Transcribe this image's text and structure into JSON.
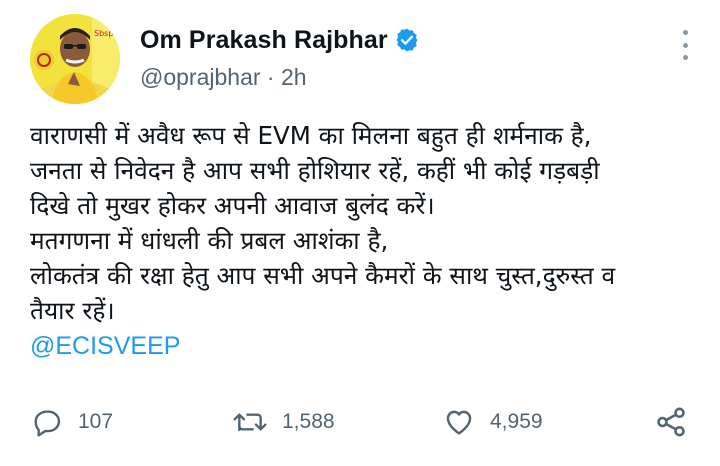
{
  "author": {
    "display_name": "Om Prakash Rajbhar",
    "handle": "@oprajbhar",
    "separator": "·",
    "time": "2h",
    "verified": true,
    "avatar_badge_text": "Sbsp"
  },
  "tweet": {
    "lines": [
      "वाराणसी में अवैध रूप से EVM का मिलना बहुत ही शर्मनाक है,",
      "जनता से निवेदन है आप सभी होशियार रहें, कहीं भी कोई गड़बड़ी",
      "दिखे तो मुखर होकर अपनी आवाज बुलंद करें।",
      "मतगणना में धांधली की प्रबल आशंका है,",
      "लोकतंत्र की रक्षा हेतु आप सभी अपने कैमरों के साथ चुस्त,दुरुस्त व",
      "तैयार रहें।"
    ],
    "mention": "@ECISVEEP"
  },
  "actions": {
    "replies": "107",
    "retweets": "1,588",
    "likes": "4,959"
  },
  "icons": {
    "reply": "reply-icon",
    "retweet": "retweet-icon",
    "like": "heart-icon",
    "share": "share-icon",
    "more": "more-vertical-icon",
    "verified": "verified-badge-icon"
  },
  "colors": {
    "link": "#1d9bf0",
    "secondary_text": "#536471",
    "avatar_bg": "#f4e23c"
  }
}
